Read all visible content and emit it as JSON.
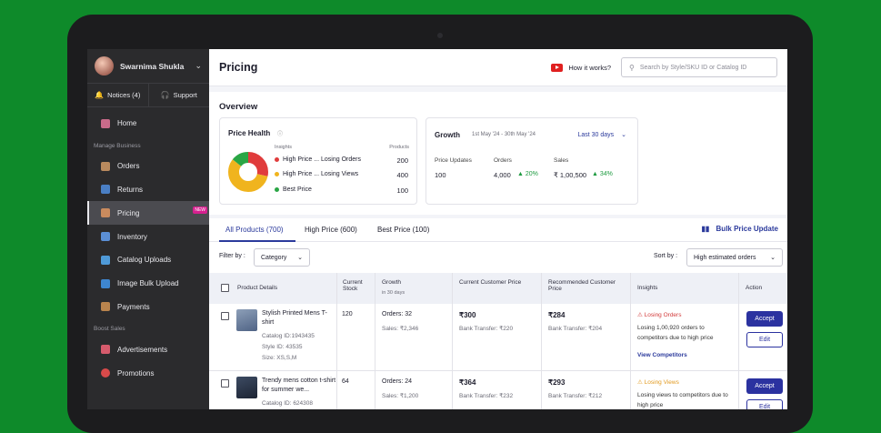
{
  "colors": {
    "background": "#0e8a2a",
    "sidebar": "#2b2b2d",
    "accent": "#2b3a9c",
    "losing_orders": "#d23a3a",
    "losing_views": "#e29a1f",
    "growth": "#1d9a3f"
  },
  "sidebar": {
    "user_name": "Swarnima Shukla",
    "notices_label": "Notices (4)",
    "support_label": "Support",
    "home_label": "Home",
    "group_manage": "Manage Business",
    "manage_items": [
      {
        "label": "Orders",
        "icon": "box-icon"
      },
      {
        "label": "Returns",
        "icon": "truck-icon"
      },
      {
        "label": "Pricing",
        "icon": "tag-icon",
        "badge": "NEW"
      },
      {
        "label": "Inventory",
        "icon": "clipboard-icon"
      },
      {
        "label": "Catalog Uploads",
        "icon": "upload-icon"
      },
      {
        "label": "Image Bulk Upload",
        "icon": "image-icon"
      },
      {
        "label": "Payments",
        "icon": "wallet-icon"
      }
    ],
    "group_boost": "Boost Sales",
    "boost_items": [
      {
        "label": "Advertisements",
        "icon": "megaphone-icon"
      },
      {
        "label": "Promotions",
        "icon": "percent-icon"
      }
    ]
  },
  "header": {
    "title": "Pricing",
    "how_it_works": "How it works?",
    "search_placeholder": "Search by Style/SKU ID or Catalog ID"
  },
  "overview": {
    "title": "Overview",
    "price_health": {
      "title": "Price Health",
      "col_insights": "Insights",
      "col_products": "Products",
      "rows": [
        {
          "label": "High Price ... Losing Orders",
          "value": "200",
          "color": "#e03c3c"
        },
        {
          "label": "High Price ... Losing Views",
          "value": "400",
          "color": "#f0b41e"
        },
        {
          "label": "Best Price",
          "value": "100",
          "color": "#2aa645"
        }
      ]
    },
    "growth": {
      "title": "Growth",
      "date_range": "1st May '24 - 30th May '24",
      "period": "Last 30 days",
      "labels": {
        "price_updates": "Price Updates",
        "orders": "Orders",
        "sales": "Sales"
      },
      "price_updates": "100",
      "orders": "4,000",
      "orders_growth": "20%",
      "sales": "₹ 1,00,500",
      "sales_growth": "34%"
    }
  },
  "tabs": {
    "all": "All Products (700)",
    "high": "High Price (600)",
    "best": "Best Price (100)",
    "bulk": "Bulk Price Update"
  },
  "filters": {
    "filter_label": "Filter by :",
    "category": "Category",
    "sort_label": "Sort by :",
    "sort_value": "High estimated orders"
  },
  "table": {
    "headers": {
      "product": "Product Details",
      "stock": "Current Stock",
      "growth": "Growth",
      "growth_sub": "in 30 days",
      "current_price": "Current Customer Price",
      "recommended": "Recommended Customer Price",
      "insights": "Insights",
      "action": "Action"
    },
    "rows": [
      {
        "name": "Stylish Printed Mens T-shirt",
        "catalog": "Catalog ID:1943435",
        "style": "Style ID: 43535",
        "size": "Size: XS,S,M",
        "stock": "120",
        "orders": "Orders: 32",
        "sales": "Sales: ₹2,346",
        "price": "₹300",
        "price_bank": "Bank Transfer: ₹220",
        "rec": "₹284",
        "rec_bank": "Bank Transfer: ₹204",
        "insight_title": "Losing Orders",
        "insight_text": "Losing 1,00,920 orders to competitors due to high price",
        "insight_link": "View Competitors",
        "accept": "Accept",
        "edit": "Edit"
      },
      {
        "name": "Trendy mens cotton t-shirt for summer we...",
        "catalog": "Catalog ID: 624308",
        "stock": "64",
        "orders": "Orders: 24",
        "sales": "Sales: ₹1,200",
        "price": "₹364",
        "price_bank": "Bank Transfer: ₹232",
        "rec": "₹293",
        "rec_bank": "Bank Transfer: ₹212",
        "insight_title": "Losing Views",
        "insight_text": "Losing views to competitors due to high price",
        "accept": "Accept",
        "edit": "Edit"
      }
    ]
  }
}
